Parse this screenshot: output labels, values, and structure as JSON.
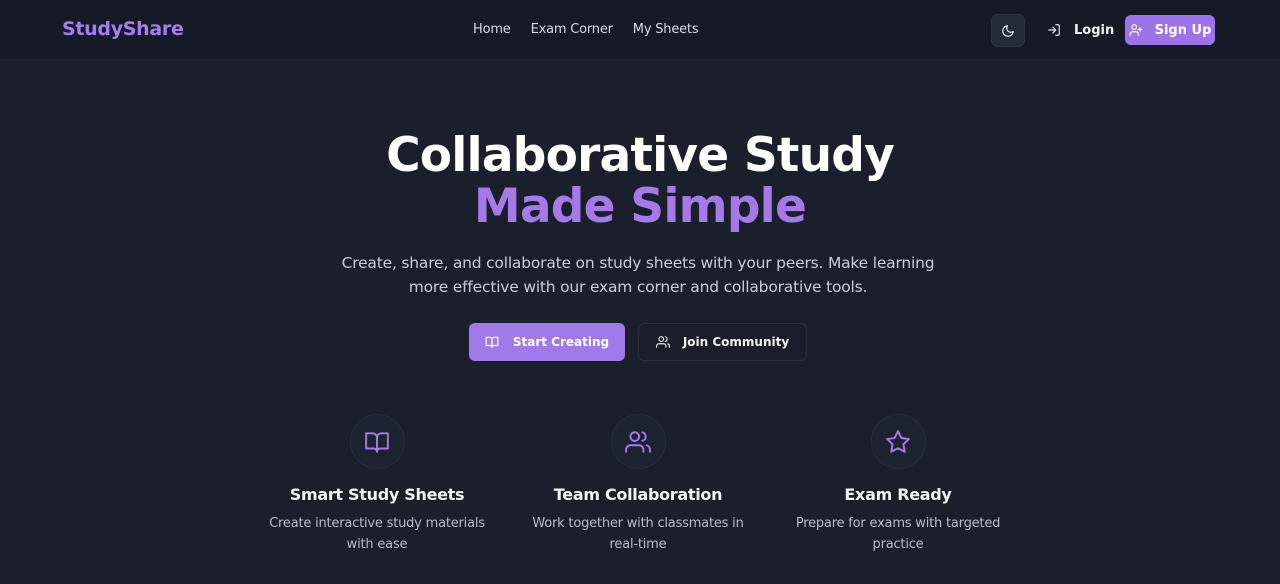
{
  "brand": {
    "name": "StudyShare"
  },
  "nav": {
    "links": [
      "Home",
      "Exam Corner",
      "My Sheets"
    ],
    "theme_toggle_icon": "moon-icon",
    "login_label": "Login",
    "signup_label": "Sign Up"
  },
  "hero": {
    "title_line1": "Collaborative Study",
    "title_line2": "Made Simple",
    "subtitle": "Create, share, and collaborate on study sheets with your peers. Make learning more effective with our exam corner and collaborative tools.",
    "primary_cta": "Start Creating",
    "secondary_cta": "Join Community"
  },
  "features": [
    {
      "icon": "book-open-icon",
      "title": "Smart Study Sheets",
      "description": "Create interactive study materials with ease"
    },
    {
      "icon": "users-icon",
      "title": "Team Collaboration",
      "description": "Work together with classmates in real-time"
    },
    {
      "icon": "star-icon",
      "title": "Exam Ready",
      "description": "Prepare for exams with targeted practice"
    }
  ],
  "colors": {
    "background": "#1b1f2c",
    "navbar": "#151a26",
    "accent": "#a57ae8",
    "primary_button": "#a07ae8"
  }
}
